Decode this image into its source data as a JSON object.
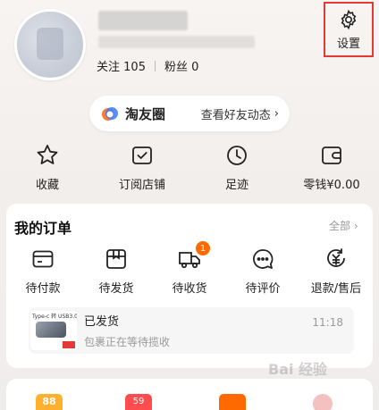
{
  "profile": {
    "following_label": "关注",
    "following_count": "105",
    "followers_label": "粉丝",
    "followers_count": "0"
  },
  "settings": {
    "label": "设置"
  },
  "taoyou": {
    "name": "淘友圈",
    "link": "查看好友动态"
  },
  "quick": [
    {
      "icon": "star-icon",
      "label": "收藏"
    },
    {
      "icon": "store-check-icon",
      "label": "订阅店铺"
    },
    {
      "icon": "clock-icon",
      "label": "足迹"
    },
    {
      "icon": "wallet-icon",
      "label": "零钱¥0.00"
    }
  ],
  "orders": {
    "title": "我的订单",
    "all_label": "全部",
    "items": [
      {
        "icon": "card-icon",
        "label": "待付款"
      },
      {
        "icon": "box-icon",
        "label": "待发货"
      },
      {
        "icon": "truck-icon",
        "label": "待收货",
        "badge": "1"
      },
      {
        "icon": "chat-icon",
        "label": "待评价"
      },
      {
        "icon": "refund-icon",
        "label": "退款/售后"
      }
    ],
    "shipment": {
      "thumb_text": "Type-c 转 USB3.0",
      "status": "已发货",
      "detail": "包裹正在等待揽收",
      "time": "11:18"
    }
  },
  "bottom": {
    "tag1": "88",
    "tag2": "59"
  },
  "watermark": "Bai 经验"
}
